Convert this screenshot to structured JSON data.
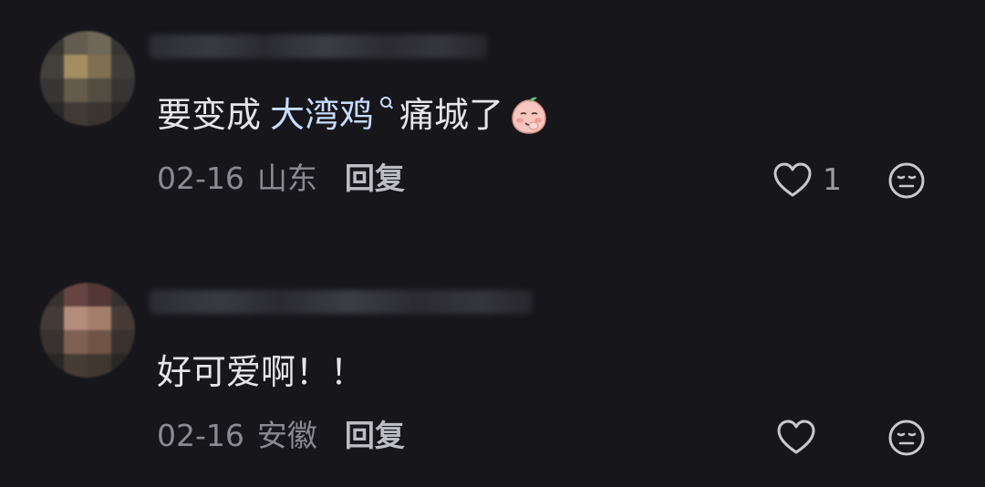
{
  "comments": [
    {
      "text_prefix": "要变成",
      "keyword": "大湾鸡",
      "text_suffix": "痛城了",
      "emoji": "blushing-peach-emoji",
      "date": "02-16",
      "region": "山东",
      "reply_label": "回复",
      "like_count": "1"
    },
    {
      "text_prefix": "好可爱啊！！",
      "keyword": "",
      "text_suffix": "",
      "date": "02-16",
      "region": "安徽",
      "reply_label": "回复",
      "like_count": ""
    }
  ],
  "icons": {
    "like": "heart-outline-icon",
    "dislike": "neutral-face-icon",
    "search_mark": "search-icon"
  },
  "colors": {
    "background": "#16161b",
    "text": "#e6e6ea",
    "keyword": "#c9dcff",
    "meta": "#8a8a92",
    "reply": "#bdbdc4"
  }
}
